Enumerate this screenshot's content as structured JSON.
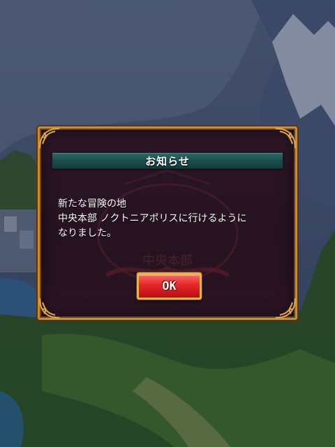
{
  "dialog": {
    "title": "お知らせ",
    "message_lines": [
      "新たな冒険の地",
      "中央本部 ノクトニアポリスに行けるように",
      "なりました。"
    ],
    "ok_label": "OK",
    "emblem_text": "中央本部"
  },
  "colors": {
    "frame_gold": "#c98d2e",
    "panel_bg": "#2c1626",
    "title_teal": "#1d4c4d",
    "ok_red": "#e52727",
    "map_sea": "#3a4a6a",
    "map_land": "#3e6b2c"
  }
}
